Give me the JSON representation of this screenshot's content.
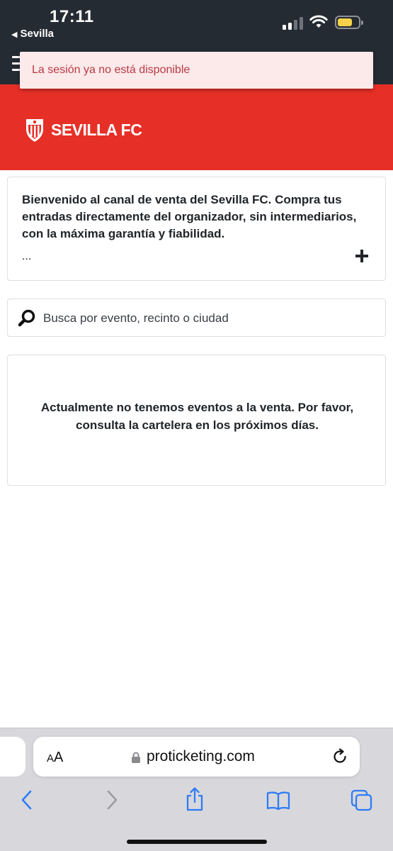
{
  "status_bar": {
    "time": "17:11",
    "back_app": "Sevilla",
    "battery_color": "#f6d24a"
  },
  "toast": {
    "message": "La sesión ya no está disponible"
  },
  "brand": {
    "name": "SEVILLA FC",
    "header_color": "#e63027"
  },
  "welcome": {
    "text": "Bienvenido al canal de venta del Sevilla FC. Compra tus entradas directamente del organizador, sin intermediarios, con la máxima garantía y fiabilidad.",
    "ellipsis": "...",
    "expand_icon": "plus-icon"
  },
  "search": {
    "placeholder": "Busca por evento, recinto o ciudad",
    "icon": "search-icon"
  },
  "events": {
    "empty_message": "Actualmente no tenemos eventos a la venta. Por favor, consulta la cartelera en los próximos días."
  },
  "browser": {
    "text_size_label_small": "A",
    "text_size_label_big": "A",
    "url": "proticketing.com",
    "accent_color": "#2f7cf6",
    "toolbar": [
      "back-icon",
      "forward-icon",
      "share-icon",
      "bookmarks-icon",
      "tabs-icon"
    ]
  }
}
